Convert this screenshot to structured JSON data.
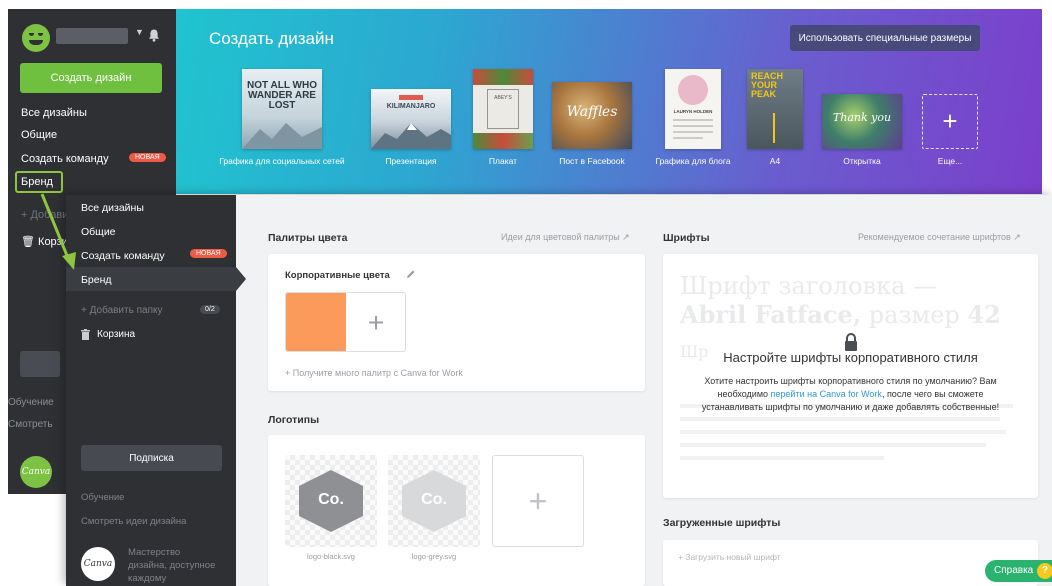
{
  "colors": {
    "sidebar": "#2e3034",
    "create_button": "#70c040",
    "badge_new": "#ef5a47",
    "brand_highlight": "#8cc63f",
    "swatch_orange": "#fc9a5b",
    "logo_black": "#8e9094",
    "logo_grey": "#d8d9db",
    "link_blue": "#2a9bd6",
    "help_green": "#2ab26f",
    "help_yellow": "#f7c81e"
  },
  "back": {
    "create_button": "Создать дизайн",
    "nav": {
      "all_designs": "Все дизайны",
      "shared": "Общие",
      "create_team": "Создать команду",
      "new_badge": "НОВАЯ",
      "brand": "Бренд",
      "add_folder": "+ Добави",
      "trash": "Корзи"
    },
    "learn": "Обучение",
    "ideas": "Смотреть",
    "logo_text": "Canva",
    "banner": {
      "title": "Создать дизайн",
      "custom_size": "Использовать специальные размеры",
      "templates": [
        {
          "label": "Графика для социальных сетей",
          "text": "NOT ALL WHO WANDER ARE LOST"
        },
        {
          "label": "Презентация",
          "text": "KILIMANJARO"
        },
        {
          "label": "Плакат",
          "text": "ABEY'S"
        },
        {
          "label": "Пост в Facebook",
          "text": "Waffles"
        },
        {
          "label": "Графика для блога",
          "text": "LAURYN HOLDEN"
        },
        {
          "label": "А4",
          "text": "REACH YOUR PEAK"
        },
        {
          "label": "Открытка",
          "text": "Thank you"
        },
        {
          "label": "Еще...",
          "text": "+"
        }
      ]
    }
  },
  "front": {
    "nav": {
      "all_designs": "Все дизайны",
      "shared": "Общие",
      "create_team": "Создать команду",
      "new_badge": "НОВАЯ",
      "brand": "Бренд",
      "add_folder": "+ Добавить папку",
      "folder_count": "0/2",
      "trash": "Корзина"
    },
    "subscribe": "Подписка",
    "learn": "Обучение",
    "ideas": "Смотреть идеи дизайна",
    "logo_text": "Canva",
    "promo": "Мастерство дизайна, доступное каждому",
    "palettes": {
      "title": "Палитры цвета",
      "link": "Идеи для цветовой палитры ↗",
      "card_title": "Корпоративные цвета",
      "add": "+",
      "promo": "+ Получите много палитр с Canva for Work"
    },
    "logos": {
      "title": "Логотипы",
      "items": [
        {
          "mark": "Co.",
          "file": "logo-black.svg"
        },
        {
          "mark": "Co.",
          "file": "logo-grey.svg"
        }
      ],
      "add": "+"
    },
    "fonts": {
      "title": "Шрифты",
      "link": "Рекомендуемое сочетание шрифтов ↗",
      "ghost_title": "Шрифт заголовка —",
      "ghost_font": "Abril Fatface,",
      "ghost_size": "размер",
      "ghost_size_value": "42",
      "ghost_subtitle": "Шр",
      "heading": "Настройте шрифты корпоративного стиля",
      "text_before": "Хотите настроить шрифты корпоративного стиля по умолчанию? Вам необходимо ",
      "text_link": "перейти на Canva for Work",
      "text_after": ", после чего вы сможете устанавливать шрифты по умолчанию и даже добавлять собственные!"
    },
    "uploaded": {
      "title": "Загруженные шрифты",
      "upload": "+ Загрузить новый шрифт"
    }
  },
  "help": {
    "label": "Справка",
    "icon": "?"
  }
}
